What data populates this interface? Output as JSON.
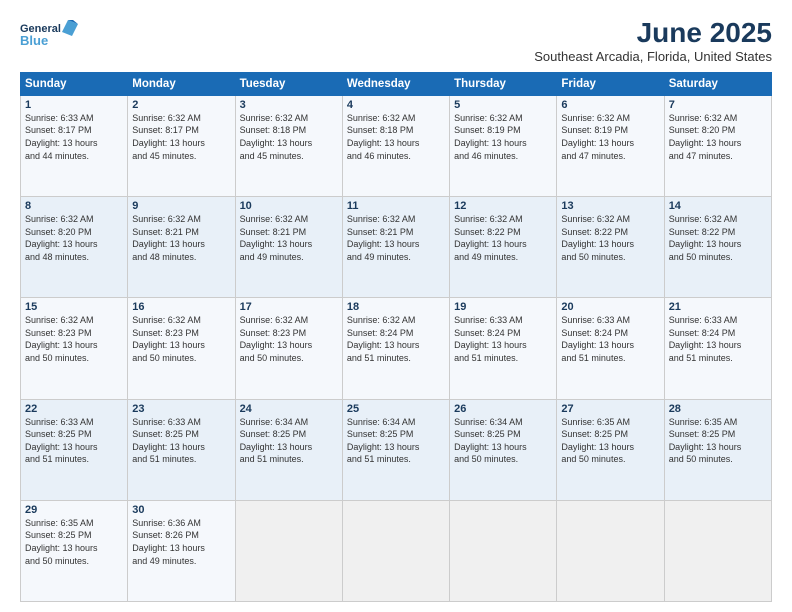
{
  "logo": {
    "line1": "General",
    "line2": "Blue",
    "icon_color": "#4a9fd4"
  },
  "title": "June 2025",
  "location": "Southeast Arcadia, Florida, United States",
  "headers": [
    "Sunday",
    "Monday",
    "Tuesday",
    "Wednesday",
    "Thursday",
    "Friday",
    "Saturday"
  ],
  "weeks": [
    [
      {
        "num": "1",
        "info": "Sunrise: 6:33 AM\nSunset: 8:17 PM\nDaylight: 13 hours\nand 44 minutes."
      },
      {
        "num": "2",
        "info": "Sunrise: 6:32 AM\nSunset: 8:17 PM\nDaylight: 13 hours\nand 45 minutes."
      },
      {
        "num": "3",
        "info": "Sunrise: 6:32 AM\nSunset: 8:18 PM\nDaylight: 13 hours\nand 45 minutes."
      },
      {
        "num": "4",
        "info": "Sunrise: 6:32 AM\nSunset: 8:18 PM\nDaylight: 13 hours\nand 46 minutes."
      },
      {
        "num": "5",
        "info": "Sunrise: 6:32 AM\nSunset: 8:19 PM\nDaylight: 13 hours\nand 46 minutes."
      },
      {
        "num": "6",
        "info": "Sunrise: 6:32 AM\nSunset: 8:19 PM\nDaylight: 13 hours\nand 47 minutes."
      },
      {
        "num": "7",
        "info": "Sunrise: 6:32 AM\nSunset: 8:20 PM\nDaylight: 13 hours\nand 47 minutes."
      }
    ],
    [
      {
        "num": "8",
        "info": "Sunrise: 6:32 AM\nSunset: 8:20 PM\nDaylight: 13 hours\nand 48 minutes."
      },
      {
        "num": "9",
        "info": "Sunrise: 6:32 AM\nSunset: 8:21 PM\nDaylight: 13 hours\nand 48 minutes."
      },
      {
        "num": "10",
        "info": "Sunrise: 6:32 AM\nSunset: 8:21 PM\nDaylight: 13 hours\nand 49 minutes."
      },
      {
        "num": "11",
        "info": "Sunrise: 6:32 AM\nSunset: 8:21 PM\nDaylight: 13 hours\nand 49 minutes."
      },
      {
        "num": "12",
        "info": "Sunrise: 6:32 AM\nSunset: 8:22 PM\nDaylight: 13 hours\nand 49 minutes."
      },
      {
        "num": "13",
        "info": "Sunrise: 6:32 AM\nSunset: 8:22 PM\nDaylight: 13 hours\nand 50 minutes."
      },
      {
        "num": "14",
        "info": "Sunrise: 6:32 AM\nSunset: 8:22 PM\nDaylight: 13 hours\nand 50 minutes."
      }
    ],
    [
      {
        "num": "15",
        "info": "Sunrise: 6:32 AM\nSunset: 8:23 PM\nDaylight: 13 hours\nand 50 minutes."
      },
      {
        "num": "16",
        "info": "Sunrise: 6:32 AM\nSunset: 8:23 PM\nDaylight: 13 hours\nand 50 minutes."
      },
      {
        "num": "17",
        "info": "Sunrise: 6:32 AM\nSunset: 8:23 PM\nDaylight: 13 hours\nand 50 minutes."
      },
      {
        "num": "18",
        "info": "Sunrise: 6:32 AM\nSunset: 8:24 PM\nDaylight: 13 hours\nand 51 minutes."
      },
      {
        "num": "19",
        "info": "Sunrise: 6:33 AM\nSunset: 8:24 PM\nDaylight: 13 hours\nand 51 minutes."
      },
      {
        "num": "20",
        "info": "Sunrise: 6:33 AM\nSunset: 8:24 PM\nDaylight: 13 hours\nand 51 minutes."
      },
      {
        "num": "21",
        "info": "Sunrise: 6:33 AM\nSunset: 8:24 PM\nDaylight: 13 hours\nand 51 minutes."
      }
    ],
    [
      {
        "num": "22",
        "info": "Sunrise: 6:33 AM\nSunset: 8:25 PM\nDaylight: 13 hours\nand 51 minutes."
      },
      {
        "num": "23",
        "info": "Sunrise: 6:33 AM\nSunset: 8:25 PM\nDaylight: 13 hours\nand 51 minutes."
      },
      {
        "num": "24",
        "info": "Sunrise: 6:34 AM\nSunset: 8:25 PM\nDaylight: 13 hours\nand 51 minutes."
      },
      {
        "num": "25",
        "info": "Sunrise: 6:34 AM\nSunset: 8:25 PM\nDaylight: 13 hours\nand 51 minutes."
      },
      {
        "num": "26",
        "info": "Sunrise: 6:34 AM\nSunset: 8:25 PM\nDaylight: 13 hours\nand 50 minutes."
      },
      {
        "num": "27",
        "info": "Sunrise: 6:35 AM\nSunset: 8:25 PM\nDaylight: 13 hours\nand 50 minutes."
      },
      {
        "num": "28",
        "info": "Sunrise: 6:35 AM\nSunset: 8:25 PM\nDaylight: 13 hours\nand 50 minutes."
      }
    ],
    [
      {
        "num": "29",
        "info": "Sunrise: 6:35 AM\nSunset: 8:25 PM\nDaylight: 13 hours\nand 50 minutes."
      },
      {
        "num": "30",
        "info": "Sunrise: 6:36 AM\nSunset: 8:26 PM\nDaylight: 13 hours\nand 49 minutes."
      },
      null,
      null,
      null,
      null,
      null
    ]
  ]
}
